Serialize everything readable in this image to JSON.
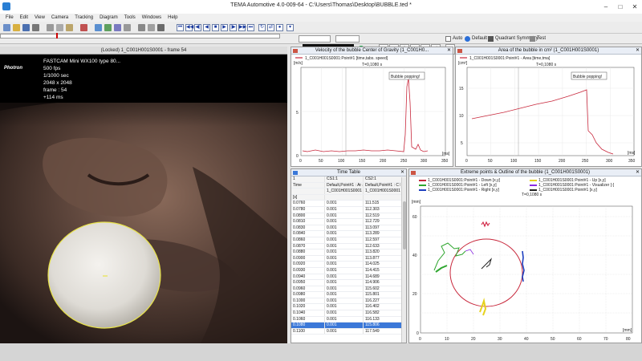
{
  "window": {
    "title": "TEMA Automotive 4.0-009-64 - C:\\Users\\Thomas\\Desktop\\BUBBLE.ted *",
    "controls": [
      "–",
      "□",
      "✕"
    ]
  },
  "menu": [
    "File",
    "Edit",
    "View",
    "Camera",
    "Tracking",
    "Diagram",
    "Tools",
    "Windows",
    "Help"
  ],
  "toolbar": {
    "counter": "0.1080",
    "auto_label": "Auto",
    "default_label": "Default",
    "quadrant_label": "Quadrant Symmetry",
    "test_label": "Test"
  },
  "colors": {
    "accent_blue": "#3b78d8",
    "plot_red": "#c8283c",
    "green": "#2fa62f",
    "blue": "#1c3fbf",
    "yellow": "#e6d21e"
  },
  "video": {
    "header": "(Locked) 1_C001H001S0001 - frame 54",
    "brand": "Photron",
    "overlay": [
      "FASTCAM Mini WX100 type 80...",
      "500 fps",
      "1/1000 sec",
      "2048 x 2048",
      "frame : 54",
      "+114 ms"
    ]
  },
  "velocity_panel": {
    "title": "Velocity of the bubble Center of Gravity (1_C001H0...",
    "legend": "1_C001H001S0001:Point#1 [time,tabs. speed]",
    "time_label": "T=0,1080 s",
    "annotation": "Bubble popping!",
    "y_unit": "[m/s]",
    "x_unit": "[ms]",
    "y_ticks": [
      "5",
      "0"
    ],
    "x_ticks": [
      "0",
      "50",
      "100",
      "150",
      "200",
      "250",
      "300",
      "350"
    ]
  },
  "area_panel": {
    "title": "Area of the bubble in cm² (1_C001H001S0001)",
    "legend": "1_C001H001S0001:Point#1 - Area [time,tma]",
    "time_label": "T=0,1080 s",
    "annotation": "Bubble popping!",
    "y_unit": "[cm²]",
    "x_unit": "[ms]",
    "y_ticks": [
      "15",
      "10",
      "5"
    ],
    "x_ticks": [
      "0",
      "50",
      "100",
      "150",
      "200",
      "250",
      "300",
      "350"
    ]
  },
  "time_table": {
    "title": "Time Table",
    "header_row1": [
      "1",
      "CS1:1",
      "CS2:1"
    ],
    "header_row2": [
      "Time",
      "Default,Point#1 : Ar area[cm²]",
      "Default,Point#1 : C length[mm]"
    ],
    "header_row3": [
      "",
      "1_C001H001S0001",
      "1_C001H001S0001"
    ],
    "unit_row": [
      "[s]",
      "",
      ""
    ],
    "rows": [
      [
        "0.0760",
        "0.001",
        "111.515"
      ],
      [
        "0.0780",
        "0.001",
        "112.303"
      ],
      [
        "0.0800",
        "0.001",
        "112.519"
      ],
      [
        "0.0810",
        "0.001",
        "112.729"
      ],
      [
        "0.0830",
        "0.001",
        "113.097"
      ],
      [
        "0.0840",
        "0.001",
        "113.289"
      ],
      [
        "0.0860",
        "0.001",
        "112.597"
      ],
      [
        "0.0870",
        "0.001",
        "112.633"
      ],
      [
        "0.0880",
        "0.001",
        "113.820"
      ],
      [
        "0.0900",
        "0.001",
        "113.877"
      ],
      [
        "0.0920",
        "0.001",
        "114.025"
      ],
      [
        "0.0930",
        "0.001",
        "114.415"
      ],
      [
        "0.0940",
        "0.001",
        "114.689"
      ],
      [
        "0.0950",
        "0.001",
        "114.906"
      ],
      [
        "0.0960",
        "0.001",
        "115.602"
      ],
      [
        "0.0980",
        "0.001",
        "115.801"
      ],
      [
        "0.1000",
        "0.001",
        "116.227"
      ],
      [
        "0.1020",
        "0.001",
        "116.402"
      ],
      [
        "0.1040",
        "0.001",
        "116.582"
      ],
      [
        "0.1060",
        "0.001",
        "116.133"
      ],
      [
        "0.1080",
        "0.001",
        "115.806"
      ],
      [
        "0.1100",
        "0.001",
        "117.549"
      ]
    ],
    "selected_index": 20
  },
  "extreme_panel": {
    "title": "Extreme points & Outline of the bubble (1_C001H001S0001)",
    "legend": [
      {
        "label": "1_C001H001S0001:Point#1 - Down [x,y]",
        "color": "#c8283c"
      },
      {
        "label": "1_C001H001S0001:Point#1 - Left [x,y]",
        "color": "#2fa62f"
      },
      {
        "label": "1_C001H001S0001:Point#1 - Right [x,y]",
        "color": "#1c3fbf"
      },
      {
        "label": "1_C001H001S0001:Point#1 - Up [x,y]",
        "color": "#e6d21e"
      },
      {
        "label": "1_C001H001S0001:Point#1 - Visualizer [-]",
        "color": "#8a2be2"
      },
      {
        "label": "1_C001H001S0001:Point#1 [x,y]",
        "color": "#222222"
      }
    ],
    "time_label": "T=0,1080 s",
    "y_unit": "[mm]",
    "x_unit": "[mm]",
    "y_ticks": [
      "60",
      "40",
      "20",
      "0"
    ],
    "x_ticks": [
      "0",
      "10",
      "20",
      "30",
      "40",
      "50",
      "60",
      "70",
      "80"
    ]
  }
}
